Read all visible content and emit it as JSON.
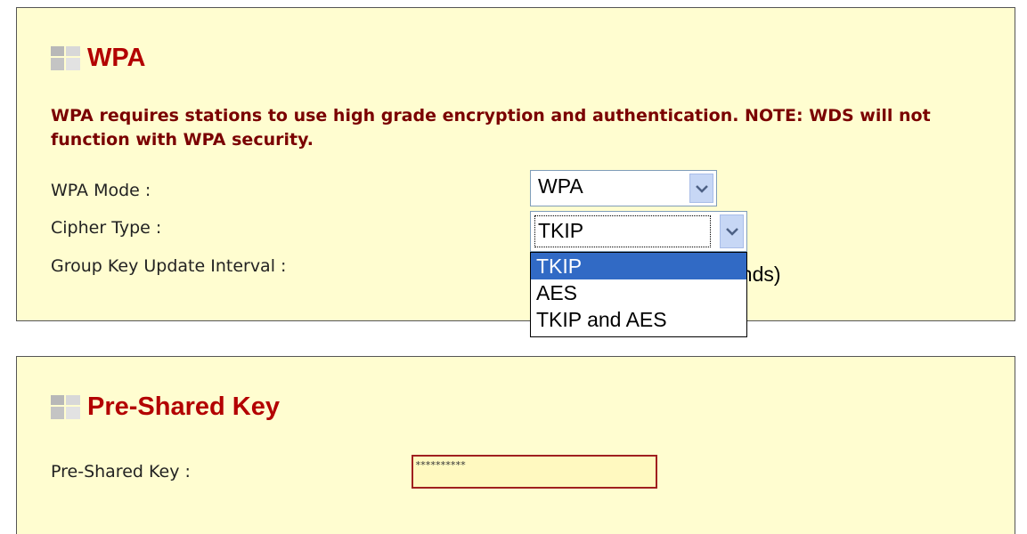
{
  "wpa_section": {
    "title": "WPA",
    "notice": "WPA requires stations to use high grade encryption and authentication. NOTE: WDS will not function with WPA security.",
    "wpa_mode": {
      "label": "WPA Mode :",
      "selected": "WPA"
    },
    "cipher_type": {
      "label": "Cipher Type :",
      "selected": "TKIP",
      "options": [
        "TKIP",
        "AES",
        "TKIP and AES"
      ],
      "highlighted": "TKIP"
    },
    "group_key_interval": {
      "label": "Group Key Update Interval :",
      "unit_visible": "onds)"
    }
  },
  "psk_section": {
    "title": "Pre-Shared Key",
    "key_label": "Pre-Shared Key :",
    "key_value": "**********"
  },
  "colors": {
    "panel_bg": "#fffdd0",
    "heading": "#b30000",
    "notice": "#7a0000",
    "selection": "#316ac5"
  },
  "icons": {
    "section_icon": "grid-squares-icon",
    "dropdown_arrow": "chevron-down-icon"
  }
}
